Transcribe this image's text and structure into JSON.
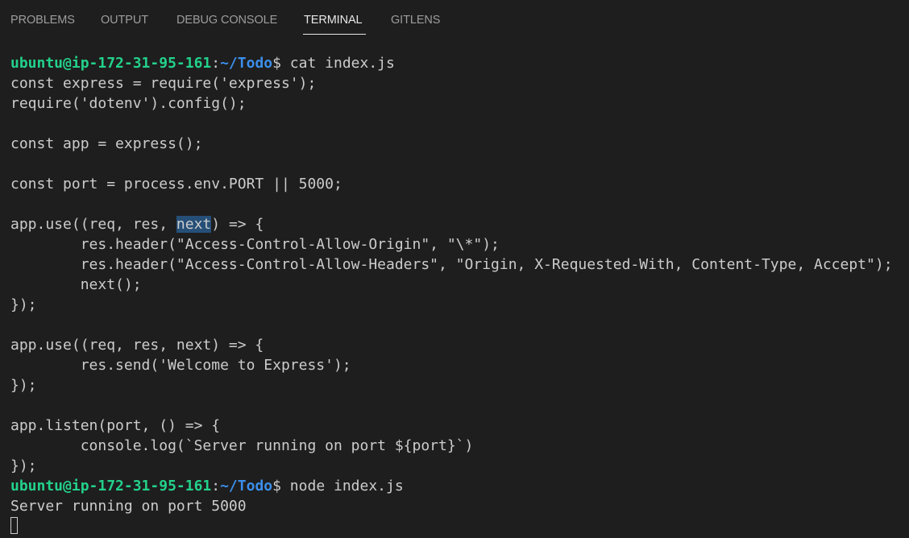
{
  "panel": {
    "tabs": [
      {
        "label": "PROBLEMS"
      },
      {
        "label": "OUTPUT"
      },
      {
        "label": "DEBUG CONSOLE"
      },
      {
        "label": "TERMINAL",
        "active": true
      },
      {
        "label": "GITLENS"
      }
    ]
  },
  "terminal": {
    "prompt": {
      "user_host": "ubuntu@ip-172-31-95-161",
      "separator": ":",
      "path": "~/Todo",
      "dollar": "$"
    },
    "commands": [
      " cat index.js",
      " node index.js"
    ],
    "code": [
      "const express = require('express');",
      "require('dotenv').config();",
      "",
      "const app = express();",
      "",
      "const port = process.env.PORT || 5000;",
      "",
      "app.use((req, res, ",
      "        res.header(\"Access-Control-Allow-Origin\", \"\\*\");",
      "        res.header(\"Access-Control-Allow-Headers\", \"Origin, X-Requested-With, Content-Type, Accept\");",
      "        next();",
      "});",
      "",
      "app.use((req, res, next) => {",
      "        res.send('Welcome to Express');",
      "});",
      "",
      "app.listen(port, () => {",
      "        console.log(`Server running on port ${port}`)",
      "});"
    ],
    "selected_word": "next",
    "selected_line_rest": ") => {",
    "output": "Server running on port 5000",
    "colors": {
      "background": "#1e1e1e",
      "prompt_user": "#23d18b",
      "prompt_path": "#3b8eea",
      "text": "#cccccc",
      "selection": "#264f78"
    }
  }
}
